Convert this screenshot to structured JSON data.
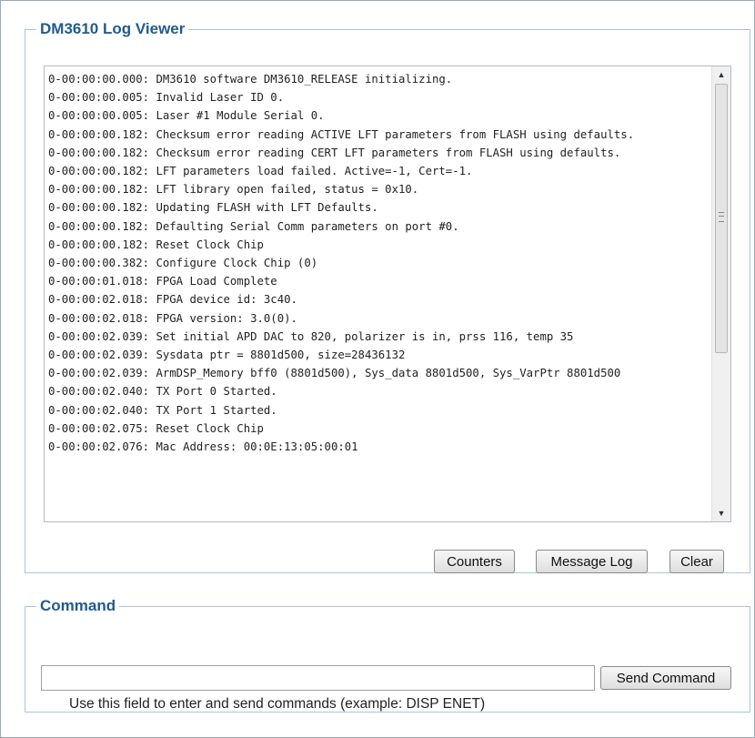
{
  "log_viewer": {
    "title": "DM3610 Log Viewer",
    "lines": [
      "0-00:00:00.000: DM3610 software DM3610_RELEASE initializing.",
      "0-00:00:00.005: Invalid Laser ID 0.",
      "0-00:00:00.005: Laser #1 Module Serial 0.",
      "0-00:00:00.182: Checksum error reading ACTIVE LFT parameters from FLASH using defaults.",
      "0-00:00:00.182: Checksum error reading CERT LFT parameters from FLASH using defaults.",
      "0-00:00:00.182: LFT parameters load failed. Active=-1, Cert=-1.",
      "0-00:00:00.182: LFT library open failed, status = 0x10.",
      "0-00:00:00.182: Updating FLASH with LFT Defaults.",
      "0-00:00:00.182: Defaulting Serial Comm parameters on port #0.",
      "0-00:00:00.182: Reset Clock Chip",
      "0-00:00:00.382: Configure Clock Chip (0)",
      "0-00:00:01.018: FPGA Load Complete",
      "0-00:00:02.018: FPGA device id: 3c40.",
      "0-00:00:02.018: FPGA version: 3.0(0).",
      "0-00:00:02.039: Set initial APD DAC to 820, polarizer is in, prss 116, temp 35",
      "0-00:00:02.039: Sysdata ptr = 8801d500, size=28436132",
      "0-00:00:02.039: ArmDSP_Memory bff0 (8801d500), Sys_data 8801d500, Sys_VarPtr 8801d500",
      "0-00:00:02.040: TX Port 0 Started.",
      "0-00:00:02.040: TX Port 1 Started.",
      "0-00:00:02.075: Reset Clock Chip",
      "0-00:00:02.076: Mac Address: 00:0E:13:05:00:01"
    ],
    "buttons": {
      "counters": "Counters",
      "message_log": "Message Log",
      "clear": "Clear"
    }
  },
  "command": {
    "title": "Command",
    "input_value": "",
    "send_label": "Send Command",
    "hint": "Use this field to enter and send commands (example: DISP ENET)"
  },
  "icons": {
    "scroll_up": "scroll-up-arrow",
    "scroll_down": "scroll-down-arrow",
    "scroll_grip": "scrollbar-grip"
  }
}
